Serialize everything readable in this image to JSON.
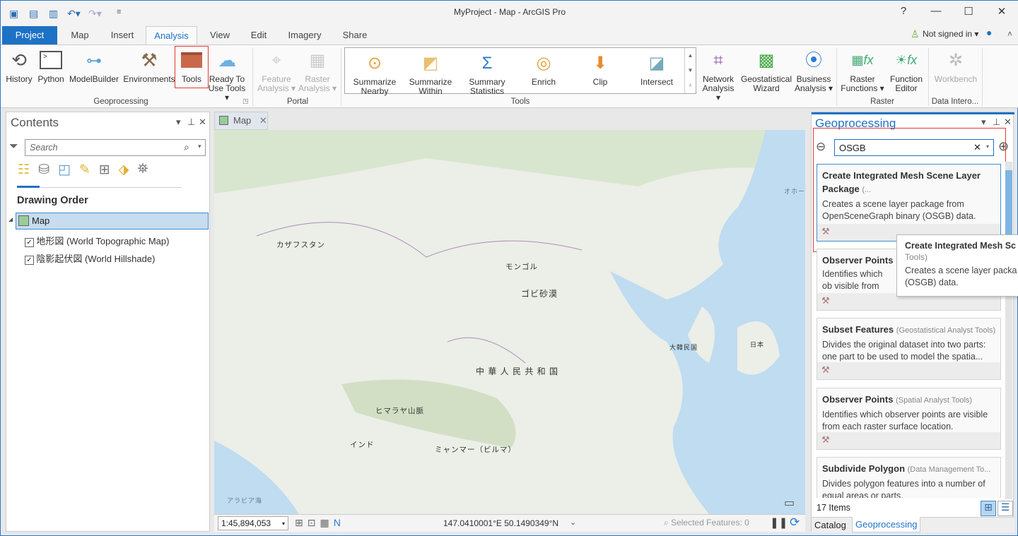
{
  "window": {
    "title": "MyProject - Map - ArcGIS Pro",
    "help": "?",
    "minimize": "—",
    "maximize": "☐",
    "close": "✕"
  },
  "ribbon_tabs": [
    "Project",
    "Map",
    "Insert",
    "Analysis",
    "View",
    "Edit",
    "Imagery",
    "Share"
  ],
  "account": {
    "label": "Not signed in ▾"
  },
  "ribbon": {
    "geoprocessing": {
      "label": "Geoprocessing",
      "buttons": [
        "History",
        "Python",
        "ModelBuilder",
        "Environments",
        "Tools",
        "Ready To Use Tools ▾"
      ]
    },
    "portal": {
      "label": "Portal",
      "buttons": [
        "Feature Analysis ▾",
        "Raster Analysis ▾"
      ]
    },
    "tools": {
      "label": "Tools",
      "buttons": [
        "Summarize Nearby",
        "Summarize Within",
        "Summary Statistics",
        "Enrich",
        "Clip",
        "Intersect"
      ]
    },
    "extra": {
      "buttons": [
        "Network Analysis ▾",
        "Geostatistical Wizard",
        "Business Analysis ▾"
      ]
    },
    "raster": {
      "label": "Raster",
      "buttons": [
        "Raster Functions ▾",
        "Function Editor"
      ]
    },
    "interop": {
      "label": "Data Intero...",
      "buttons": [
        "Workbench"
      ]
    }
  },
  "contents": {
    "title": "Contents",
    "search_placeholder": "Search",
    "heading": "Drawing Order",
    "map_item": "Map",
    "layers": [
      {
        "name": "地形図 (World Topographic Map)",
        "checked": true
      },
      {
        "name": "陰影起伏図 (World Hillshade)",
        "checked": true
      }
    ]
  },
  "map": {
    "tab": "Map",
    "labels": [
      "カザフスタン",
      "モンゴル",
      "ゴビ砂漠",
      "中 華 人 民 共 和 国",
      "ヒマラヤ山脈",
      "インド",
      "ミャンマー（ビルマ）",
      "大韓民国",
      "日本",
      "アラビア海",
      "オホー"
    ],
    "scale": "1:45,894,053",
    "coordinates": "147.0410001°E 50.1490349°N",
    "selected": "Selected Features: 0"
  },
  "geoprocessing": {
    "title": "Geoprocessing",
    "search_value": "OSGB",
    "results": [
      {
        "name": "Create Integrated Mesh Scene Layer Package",
        "toolbox": "(...",
        "desc": "Creates a scene layer package from OpenSceneGraph binary (OSGB) data."
      },
      {
        "name": "Observer Points",
        "toolbox": "",
        "desc": "Identifies which ob visible from each r"
      },
      {
        "name": "Subset Features",
        "toolbox": "(Geostatistical Analyst Tools)",
        "desc": "Divides the original dataset into two parts: one part to be used to model the spatia..."
      },
      {
        "name": "Observer Points",
        "toolbox": "(Spatial Analyst Tools)",
        "desc": "Identifies which observer points are visible from each raster surface location."
      },
      {
        "name": "Subdivide Polygon",
        "toolbox": "(Data Management To...",
        "desc": "Divides polygon features into a number of equal areas or parts."
      }
    ],
    "tooltip": {
      "title": "Create Integrated Mesh Sc",
      "toolbox": "Tools)",
      "desc": "Creates a scene layer packa (OSGB) data."
    },
    "count": "17 Items",
    "bottom_tabs": [
      "Catalog",
      "Geoprocessing"
    ]
  },
  "colors": {
    "accent": "#1e72c5",
    "highlight": "#e53935"
  }
}
